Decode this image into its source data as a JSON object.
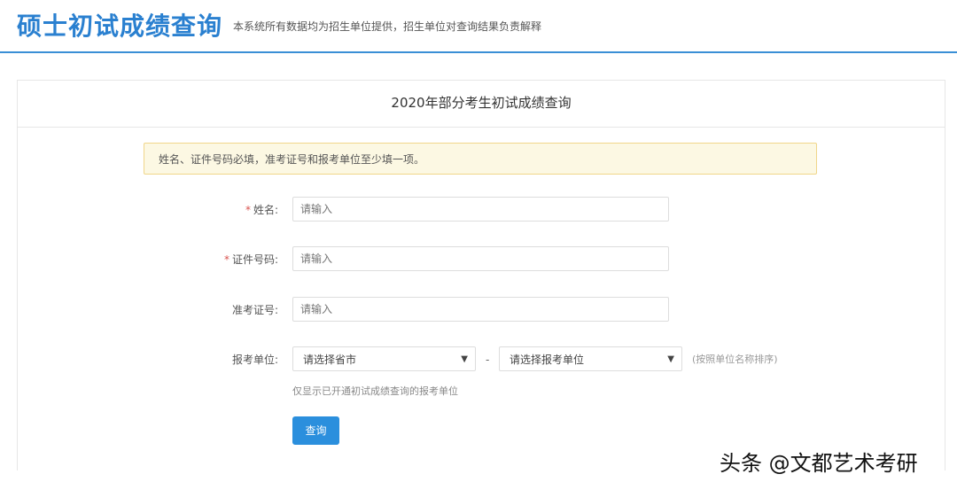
{
  "header": {
    "title": "硕士初试成绩查询",
    "subtitle": "本系统所有数据均为招生单位提供，招生单位对查询结果负责解释"
  },
  "card": {
    "title": "2020年部分考生初试成绩查询",
    "notice": "姓名、证件号码必填，准考证号和报考单位至少填一项。",
    "fields": {
      "name": {
        "label": "姓名:",
        "placeholder": "请输入",
        "required": "*"
      },
      "id": {
        "label": "证件号码:",
        "placeholder": "请输入",
        "required": "*"
      },
      "ticket": {
        "label": "准考证号:",
        "placeholder": "请输入"
      }
    },
    "unit": {
      "label": "报考单位:",
      "province": "请选择省市",
      "school": "请选择报考单位",
      "separator": "-",
      "sort_hint": "(按照单位名称排序)",
      "note": "仅显示已开通初试成绩查询的报考单位",
      "arrow": "▼"
    },
    "submit": "查询"
  },
  "watermark": "头条 @文都艺术考研"
}
